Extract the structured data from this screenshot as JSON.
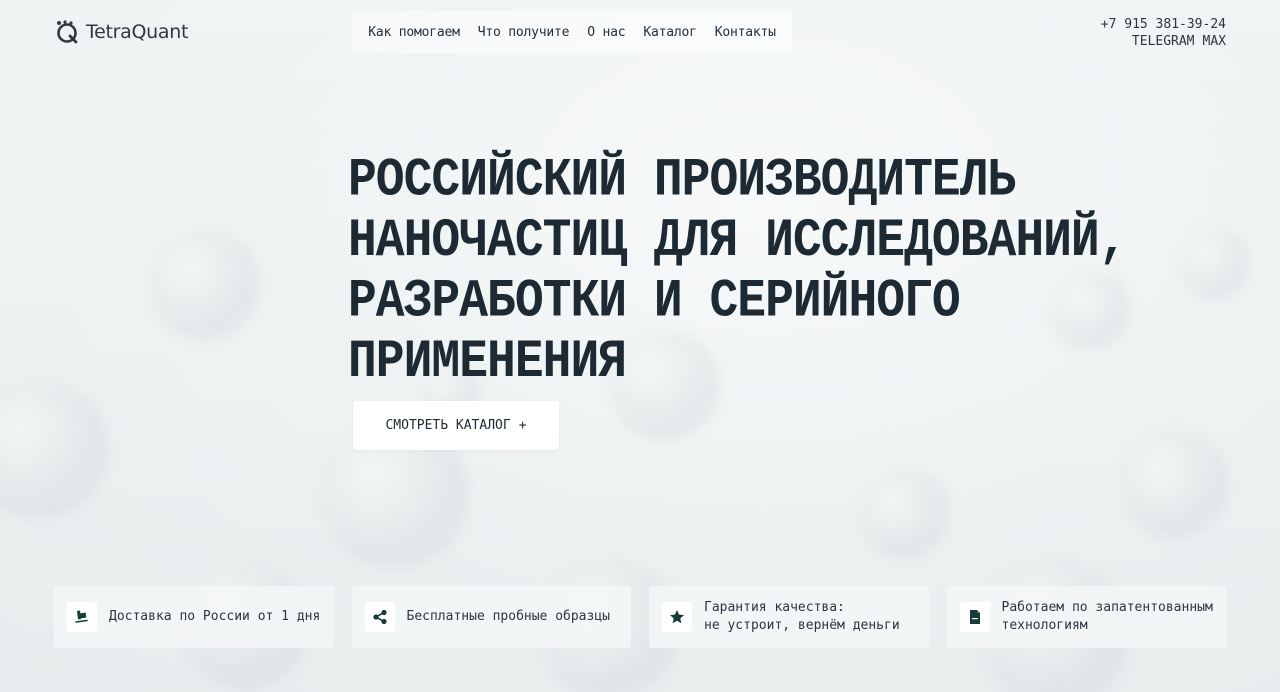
{
  "header": {
    "brand": "TetraQuant",
    "nav": [
      {
        "label": "Как помогаем"
      },
      {
        "label": "Что получите"
      },
      {
        "label": "О нас"
      },
      {
        "label": "Каталог"
      },
      {
        "label": "Контакты"
      }
    ],
    "phone": "+7 915 381-39-24",
    "socials": [
      "TELEGRAM",
      "MAX"
    ]
  },
  "hero": {
    "title_lines": [
      "РОССИЙСКИЙ ПРОИЗВОДИТЕЛЬ",
      "НАНОЧАСТИЦ ДЛЯ ИССЛЕДОВАНИЙ,",
      "РАЗРАБОТКИ И СЕРИЙНОГО",
      "ПРИМЕНЕНИЯ"
    ],
    "cta_label": "СМОТРЕТЬ КАТАЛОГ",
    "cta_symbol": "+"
  },
  "features": [
    {
      "icon": "truck-icon",
      "line1": "Доставка по России от 1 дня",
      "line2": ""
    },
    {
      "icon": "share-nodes-icon",
      "line1": "Бесплатные пробные образцы",
      "line2": ""
    },
    {
      "icon": "star-icon",
      "line1": "Гарантия качества:",
      "line2": "не устроит, вернём деньги"
    },
    {
      "icon": "document-icon",
      "line1": "Работаем по запатентованным",
      "line2": "технологиям"
    }
  ],
  "colors": {
    "text": "#1d2a33",
    "icon": "#163c3c",
    "background": "#eef1f2"
  }
}
